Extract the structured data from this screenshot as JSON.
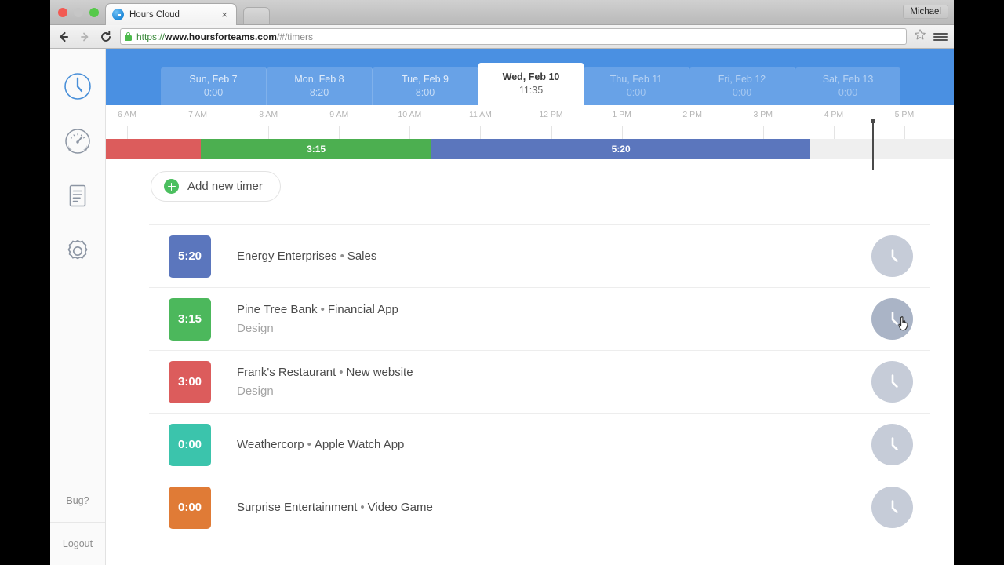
{
  "browser": {
    "tab_title": "Hours Cloud",
    "tab_close_label": "×",
    "url_scheme": "https://",
    "url_host": "www.hoursforteams.com",
    "url_path": "/#/timers",
    "chrome_user": "Michael",
    "favicon": "clock-icon",
    "lock_icon": "lock-icon",
    "back_icon": "back-arrow-icon",
    "forward_icon": "forward-arrow-icon",
    "reload_icon": "reload-icon",
    "star_icon": "star-icon",
    "menu_icon": "hamburger-menu-icon"
  },
  "sidebar": {
    "items": [
      {
        "name": "timers",
        "icon": "clock-icon",
        "active": true
      },
      {
        "name": "dashboard",
        "icon": "gauge-icon",
        "active": false
      },
      {
        "name": "reports",
        "icon": "document-icon",
        "active": false
      },
      {
        "name": "settings",
        "icon": "gear-icon",
        "active": false
      }
    ],
    "footer": [
      {
        "name": "bug",
        "label": "Bug?"
      },
      {
        "name": "logout",
        "label": "Logout"
      }
    ]
  },
  "week": {
    "days": [
      {
        "name": "Sun, Feb 7",
        "total": "0:00",
        "active": false,
        "faded": false
      },
      {
        "name": "Mon, Feb 8",
        "total": "8:20",
        "active": false,
        "faded": false
      },
      {
        "name": "Tue, Feb 9",
        "total": "8:00",
        "active": false,
        "faded": false
      },
      {
        "name": "Wed, Feb 10",
        "total": "11:35",
        "active": true,
        "faded": false
      },
      {
        "name": "Thu, Feb 11",
        "total": "0:00",
        "active": false,
        "faded": true
      },
      {
        "name": "Fri, Feb 12",
        "total": "0:00",
        "active": false,
        "faded": true
      },
      {
        "name": "Sat, Feb 13",
        "total": "0:00",
        "active": false,
        "faded": true
      }
    ]
  },
  "timeline": {
    "hours": [
      "6 AM",
      "7 AM",
      "8 AM",
      "9 AM",
      "10 AM",
      "11 AM",
      "12 PM",
      "1 PM",
      "2 PM",
      "3 PM",
      "4 PM",
      "5 PM"
    ],
    "segments": [
      {
        "label": "",
        "color": "#dc5c5c",
        "start_pct": 0.0,
        "end_pct": 11.2,
        "name": "franks-restaurant"
      },
      {
        "label": "3:15",
        "color": "#4caf50",
        "start_pct": 11.2,
        "end_pct": 38.4,
        "name": "pine-tree-bank"
      },
      {
        "label": "5:20",
        "color": "#5b76bd",
        "start_pct": 38.4,
        "end_pct": 83.1,
        "name": "energy-enterprises"
      }
    ],
    "now_marker_pct": 90.4
  },
  "toolbar": {
    "add_timer_label": "Add new timer",
    "add_icon": "plus-circle-icon"
  },
  "timers": [
    {
      "time": "5:20",
      "color": "#5b76bd",
      "client": "Energy Enterprises",
      "sep": "•",
      "project": "Sales",
      "sub": "",
      "hover": false
    },
    {
      "time": "3:15",
      "color": "#4cb85c",
      "client": "Pine Tree Bank",
      "sep": "•",
      "project": "Financial App",
      "sub": "Design",
      "hover": true
    },
    {
      "time": "3:00",
      "color": "#dc5c5c",
      "client": "Frank's Restaurant",
      "sep": "•",
      "project": "New website",
      "sub": "Design",
      "hover": false
    },
    {
      "time": "0:00",
      "color": "#3bc4ac",
      "client": "Weathercorp",
      "sep": "•",
      "project": "Apple Watch App",
      "sub": "",
      "hover": false
    },
    {
      "time": "0:00",
      "color": "#e07b36",
      "client": "Surprise Entertainment",
      "sep": "•",
      "project": "Video Game",
      "sub": "",
      "hover": false
    }
  ],
  "colors": {
    "brand_blue": "#4a90e2",
    "clock_button": "#c6ccd8",
    "clock_button_hover": "#aab4c6"
  }
}
